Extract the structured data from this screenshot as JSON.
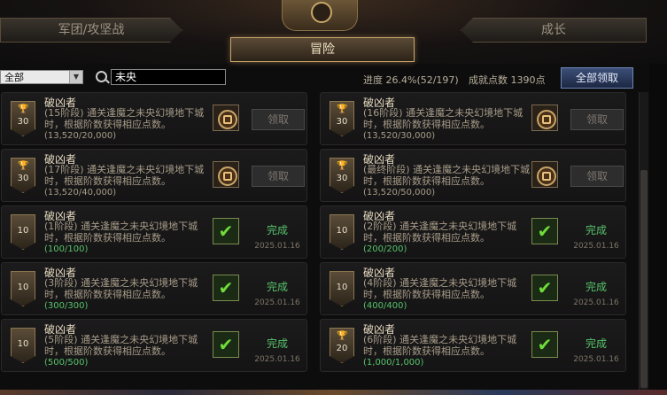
{
  "tabs": {
    "left": "军团/攻坚战",
    "right": "成长",
    "active": "冒险"
  },
  "filter": {
    "select_value": "全部",
    "search_value": "未央"
  },
  "stats": {
    "progress": "进度 26.4%(52/197)",
    "points": "成就点数 1390点"
  },
  "claim_all_label": "全部领取",
  "achievements": [
    {
      "title": "破凶者",
      "desc": "(15阶段) 通关逢魔之未央幻境地下城时，根据阶数获得相应点数。",
      "progress": "(13,520/20,000)",
      "points": "30",
      "status": "pending",
      "button": "领取"
    },
    {
      "title": "破凶者",
      "desc": "(16阶段) 通关逢魔之未央幻境地下城时，根据阶数获得相应点数。",
      "progress": "(13,520/30,000)",
      "points": "30",
      "status": "pending",
      "button": "领取"
    },
    {
      "title": "破凶者",
      "desc": "(17阶段) 通关逢魔之未央幻境地下城时，根据阶数获得相应点数。",
      "progress": "(13,520/40,000)",
      "points": "30",
      "status": "pending",
      "button": "领取"
    },
    {
      "title": "破凶者",
      "desc": "(最终阶段) 通关逢魔之未央幻境地下城时，根据阶数获得相应点数。",
      "progress": "(13,520/50,000)",
      "points": "30",
      "status": "pending",
      "button": "领取"
    },
    {
      "title": "破凶者",
      "desc": "(1阶段) 通关逢魔之未央幻境地下城时，根据阶数获得相应点数。",
      "progress": "(100/100)",
      "points": "10",
      "status": "done",
      "status_label": "完成",
      "date": "2025.01.16"
    },
    {
      "title": "破凶者",
      "desc": "(2阶段) 通关逢魔之未央幻境地下城时，根据阶数获得相应点数。",
      "progress": "(200/200)",
      "points": "10",
      "status": "done",
      "status_label": "完成",
      "date": "2025.01.16"
    },
    {
      "title": "破凶者",
      "desc": "(3阶段) 通关逢魔之未央幻境地下城时，根据阶数获得相应点数。",
      "progress": "(300/300)",
      "points": "10",
      "status": "done",
      "status_label": "完成",
      "date": "2025.01.16"
    },
    {
      "title": "破凶者",
      "desc": "(4阶段) 通关逢魔之未央幻境地下城时，根据阶数获得相应点数。",
      "progress": "(400/400)",
      "points": "10",
      "status": "done",
      "status_label": "完成",
      "date": "2025.01.16"
    },
    {
      "title": "破凶者",
      "desc": "(5阶段) 通关逢魔之未央幻境地下城时，根据阶数获得相应点数。",
      "progress": "(500/500)",
      "points": "10",
      "status": "done",
      "status_label": "完成",
      "date": "2025.01.16"
    },
    {
      "title": "破凶者",
      "desc": "(6阶段) 通关逢魔之未央幻境地下城时，根据阶数获得相应点数。",
      "progress": "(1,000/1,000)",
      "points": "20",
      "status": "done",
      "status_label": "完成",
      "date": "2025.01.16"
    }
  ]
}
